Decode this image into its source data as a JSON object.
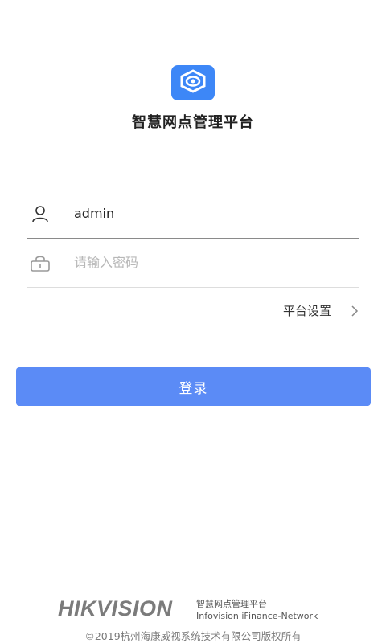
{
  "app": {
    "title": "智慧网点管理平台"
  },
  "login": {
    "username_value": "admin",
    "password_placeholder": "请输入密码",
    "platform_settings_label": "平台设置",
    "login_button_label": "登录"
  },
  "footer": {
    "brand": "HIKVISION",
    "product_name": "智慧网点管理平台",
    "product_sub": "Infovision iFinance-Network",
    "copyright": "©2019杭州海康威视系统技术有限公司版权所有"
  },
  "colors": {
    "logo_bg": "#3d87f7",
    "button_bg": "#5b8bf6",
    "brand_gray": "#7b7b7b"
  },
  "icons": {
    "logo": "camera-logo-icon",
    "user": "user-icon",
    "lock": "lock-icon",
    "chevron": "chevron-right-icon"
  }
}
